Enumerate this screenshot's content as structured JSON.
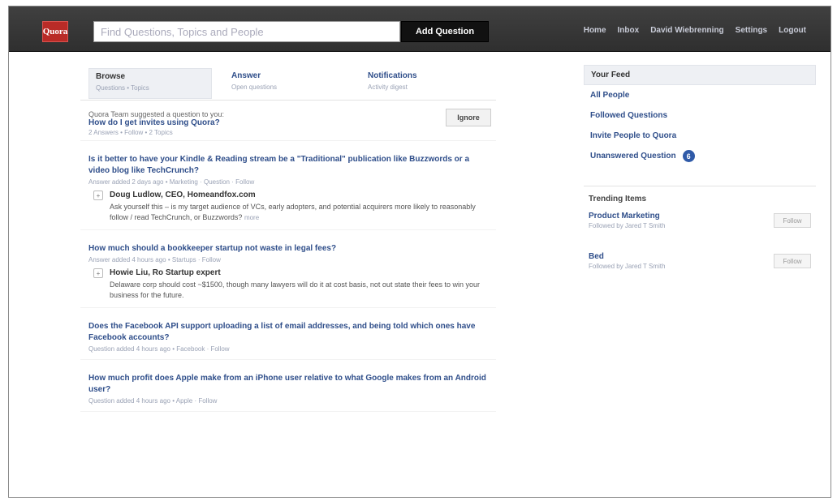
{
  "header": {
    "logo": "Quora",
    "search_placeholder": "Find Questions, Topics and People",
    "add_question": "Add Question",
    "nav": [
      "Home",
      "Inbox",
      "David Wiebrenning",
      "Settings",
      "Logout"
    ]
  },
  "tabs": [
    {
      "title": "Browse",
      "sub": "Questions • Topics"
    },
    {
      "title": "Answer",
      "sub": "Open questions"
    },
    {
      "title": "Notifications",
      "sub": "Activity digest"
    }
  ],
  "suggestion": {
    "note": "Quora Team suggested a question to you:",
    "question": "How do I get invites using Quora?",
    "meta": "2 Answers • Follow • 2 Topics",
    "ignore": "Ignore"
  },
  "feed": [
    {
      "title": "Is it better to have your Kindle & Reading stream be a \"Traditional\" publication like Buzzwords or a video blog like TechCrunch?",
      "sub": "Answer added 2 days ago • Marketing · Question · Follow",
      "answer": {
        "vote": "+",
        "author": "Doug Ludlow, CEO, Homeandfox.com",
        "body": "Ask yourself this – is my target audience of VCs, early adopters, and potential acquirers more likely to reasonably follow / read TechCrunch, or Buzzwords?",
        "more": "more"
      }
    },
    {
      "title": "How much should a bookkeeper startup not waste in legal fees?",
      "sub": "Answer added 4 hours ago • Startups · Follow",
      "answer": {
        "vote": "+",
        "author": "Howie Liu, Ro Startup expert",
        "body": "Delaware corp should cost ~$1500, though many lawyers will do it at cost basis, not out state their fees to win your business for the future.",
        "more": ""
      }
    },
    {
      "title": "Does the Facebook API support uploading a list of email addresses, and being told which ones have Facebook accounts?",
      "sub": "Question added 4 hours ago • Facebook · Follow",
      "answer": null
    },
    {
      "title": "How much profit does Apple make from an iPhone user relative to what Google makes from an Android user?",
      "sub": "Question added 4 hours ago • Apple · Follow",
      "answer": null
    }
  ],
  "side_nav": [
    {
      "label": "Your Feed",
      "active": true,
      "badge": ""
    },
    {
      "label": "All People",
      "active": false,
      "badge": ""
    },
    {
      "label": "Followed Questions",
      "active": false,
      "badge": ""
    },
    {
      "label": "Invite People to Quora",
      "active": false,
      "badge": ""
    },
    {
      "label": "Unanswered Question",
      "active": false,
      "badge": "6"
    }
  ],
  "trending": {
    "head": "Trending Items",
    "topics": [
      {
        "name": "Product Marketing",
        "meta": "Followed by Jared T Smith",
        "follow": "Follow"
      },
      {
        "name": "Bed",
        "meta": "Followed by Jared T Smith",
        "follow": "Follow"
      }
    ]
  }
}
